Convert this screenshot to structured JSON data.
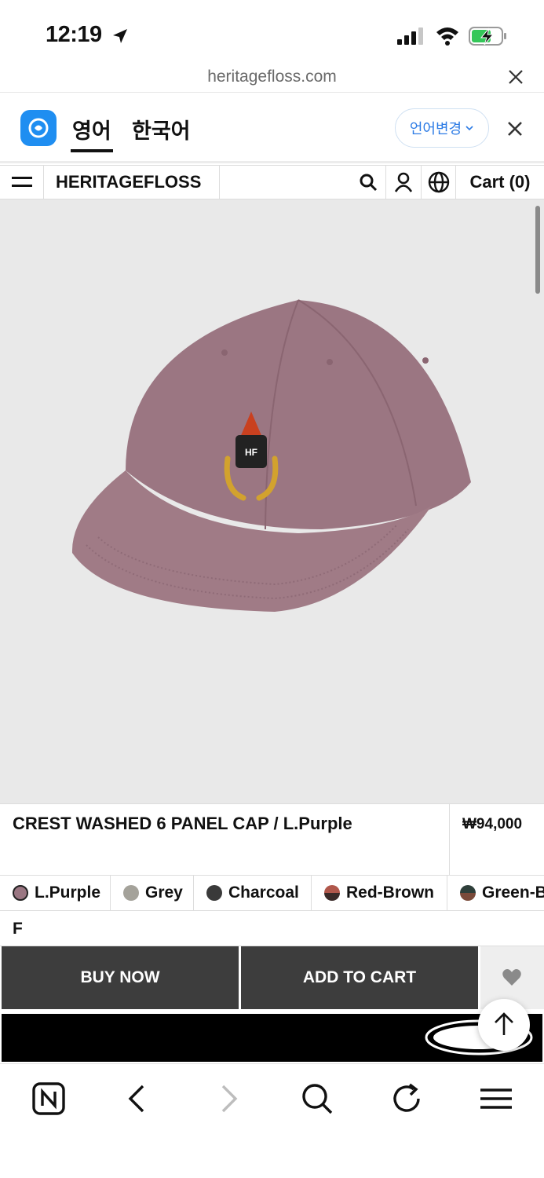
{
  "status_bar": {
    "time": "12:19"
  },
  "browser": {
    "url": "heritagefloss.com"
  },
  "translate_bar": {
    "tabs": [
      "영어",
      "한국어"
    ],
    "active_tab": "영어",
    "change_label": "언어변경"
  },
  "header": {
    "brand": "HERITAGEFLOSS",
    "cart_label": "Cart (0)"
  },
  "gallery": {
    "slides": 5,
    "active_slide": 1
  },
  "product": {
    "title": "CREST WASHED 6 PANEL CAP / L.Purple",
    "price": "₩94,000",
    "colors": [
      {
        "name": "L.Purple",
        "swatch": "#9a7682"
      },
      {
        "name": "Grey",
        "swatch": "#a4a29a"
      },
      {
        "name": "Charcoal",
        "swatch": "#3a3a3a"
      },
      {
        "name": "Red-Brown",
        "swatch": "#b0574b"
      },
      {
        "name": "Green-B",
        "swatch": "#2e3f3a"
      }
    ],
    "size": "F"
  },
  "actions": {
    "buy_now": "BUY NOW",
    "add_to_cart": "ADD TO CART"
  },
  "colors": {
    "button_bg": "#3d3d3d",
    "image_bg": "#e9e9e9",
    "accent_blue": "#2c7be5",
    "cap": "#9b7682"
  }
}
